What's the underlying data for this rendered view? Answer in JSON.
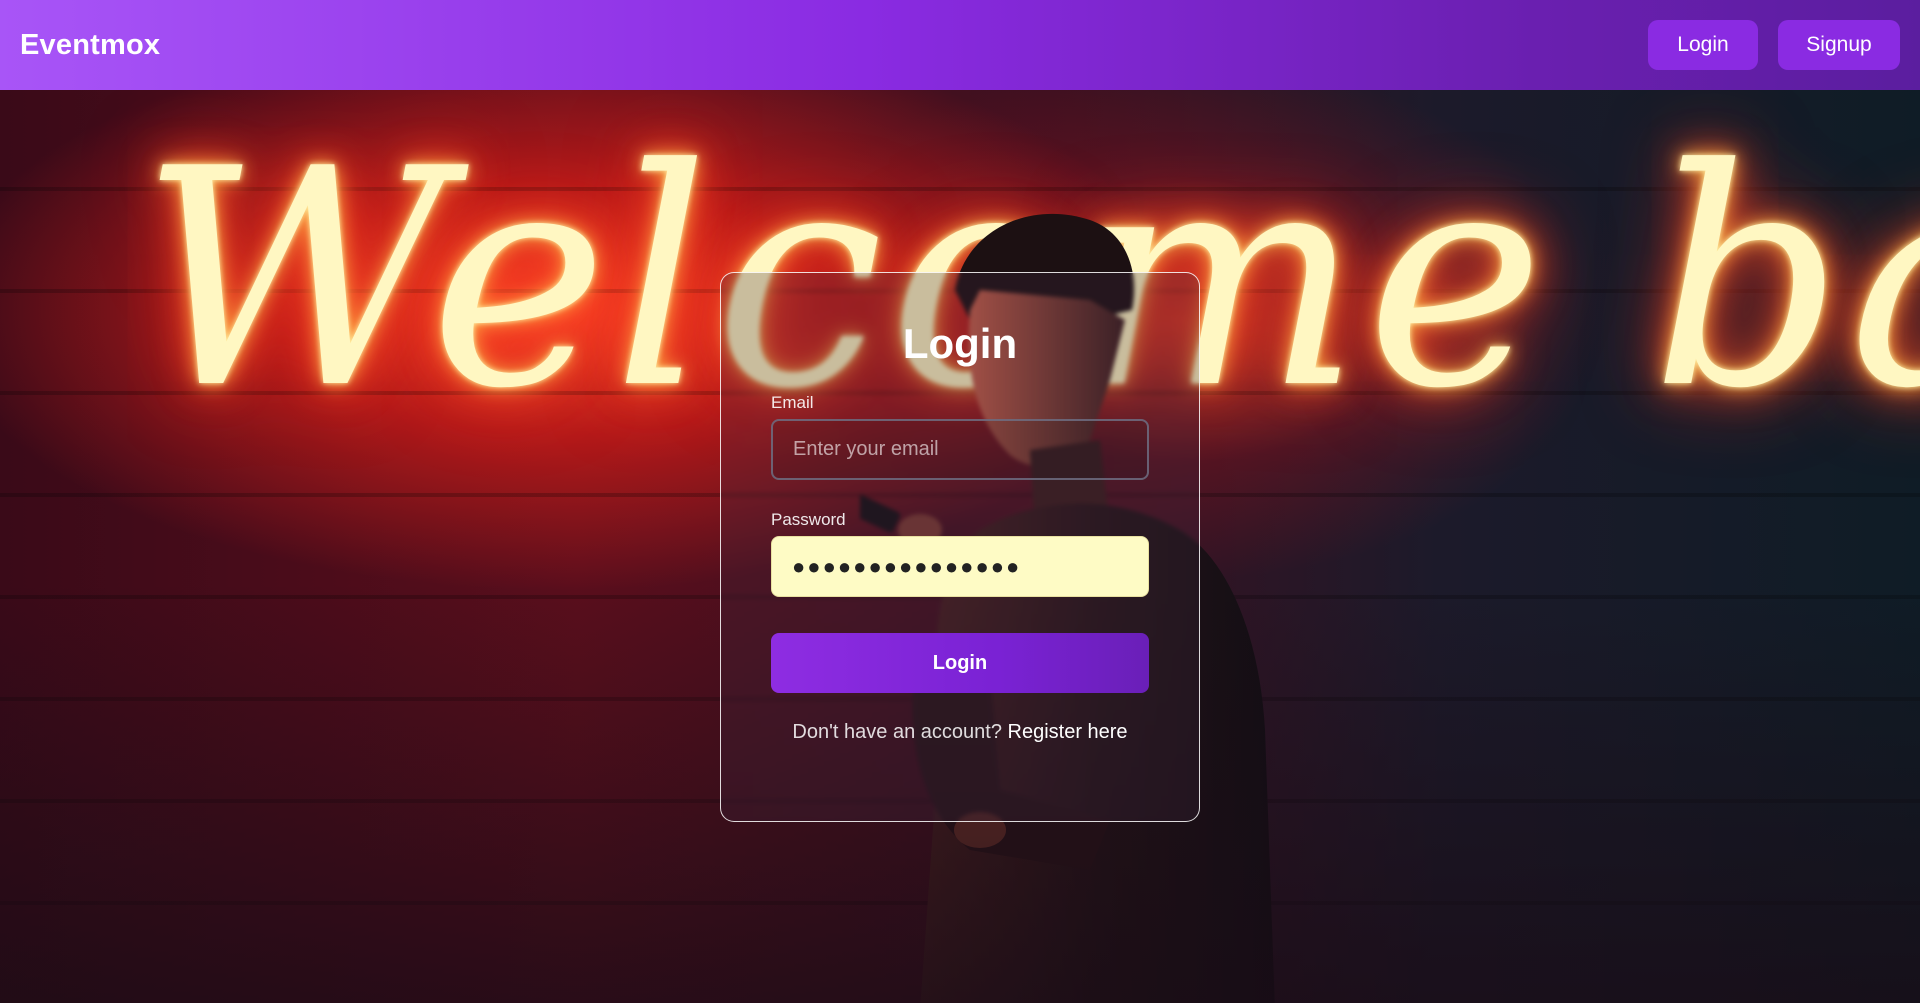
{
  "navbar": {
    "brand": "Eventmox",
    "login_label": "Login",
    "signup_label": "Signup"
  },
  "hero": {
    "neon_text": "Welcome back"
  },
  "login_form": {
    "title": "Login",
    "email_label": "Email",
    "email_placeholder": "Enter your email",
    "email_value": "",
    "password_label": "Password",
    "password_value": "●●●●●●●●●●●●●●●",
    "submit_label": "Login",
    "register_prompt": "Don't have an account?",
    "register_link": "Register here"
  },
  "colors": {
    "primary": "#8a2be2",
    "navbar_gradient_start": "#a855f7",
    "navbar_gradient_end": "#5b1e9f",
    "autofill_bg": "#fefbc5",
    "neon_glow": "#ff5a2a"
  }
}
